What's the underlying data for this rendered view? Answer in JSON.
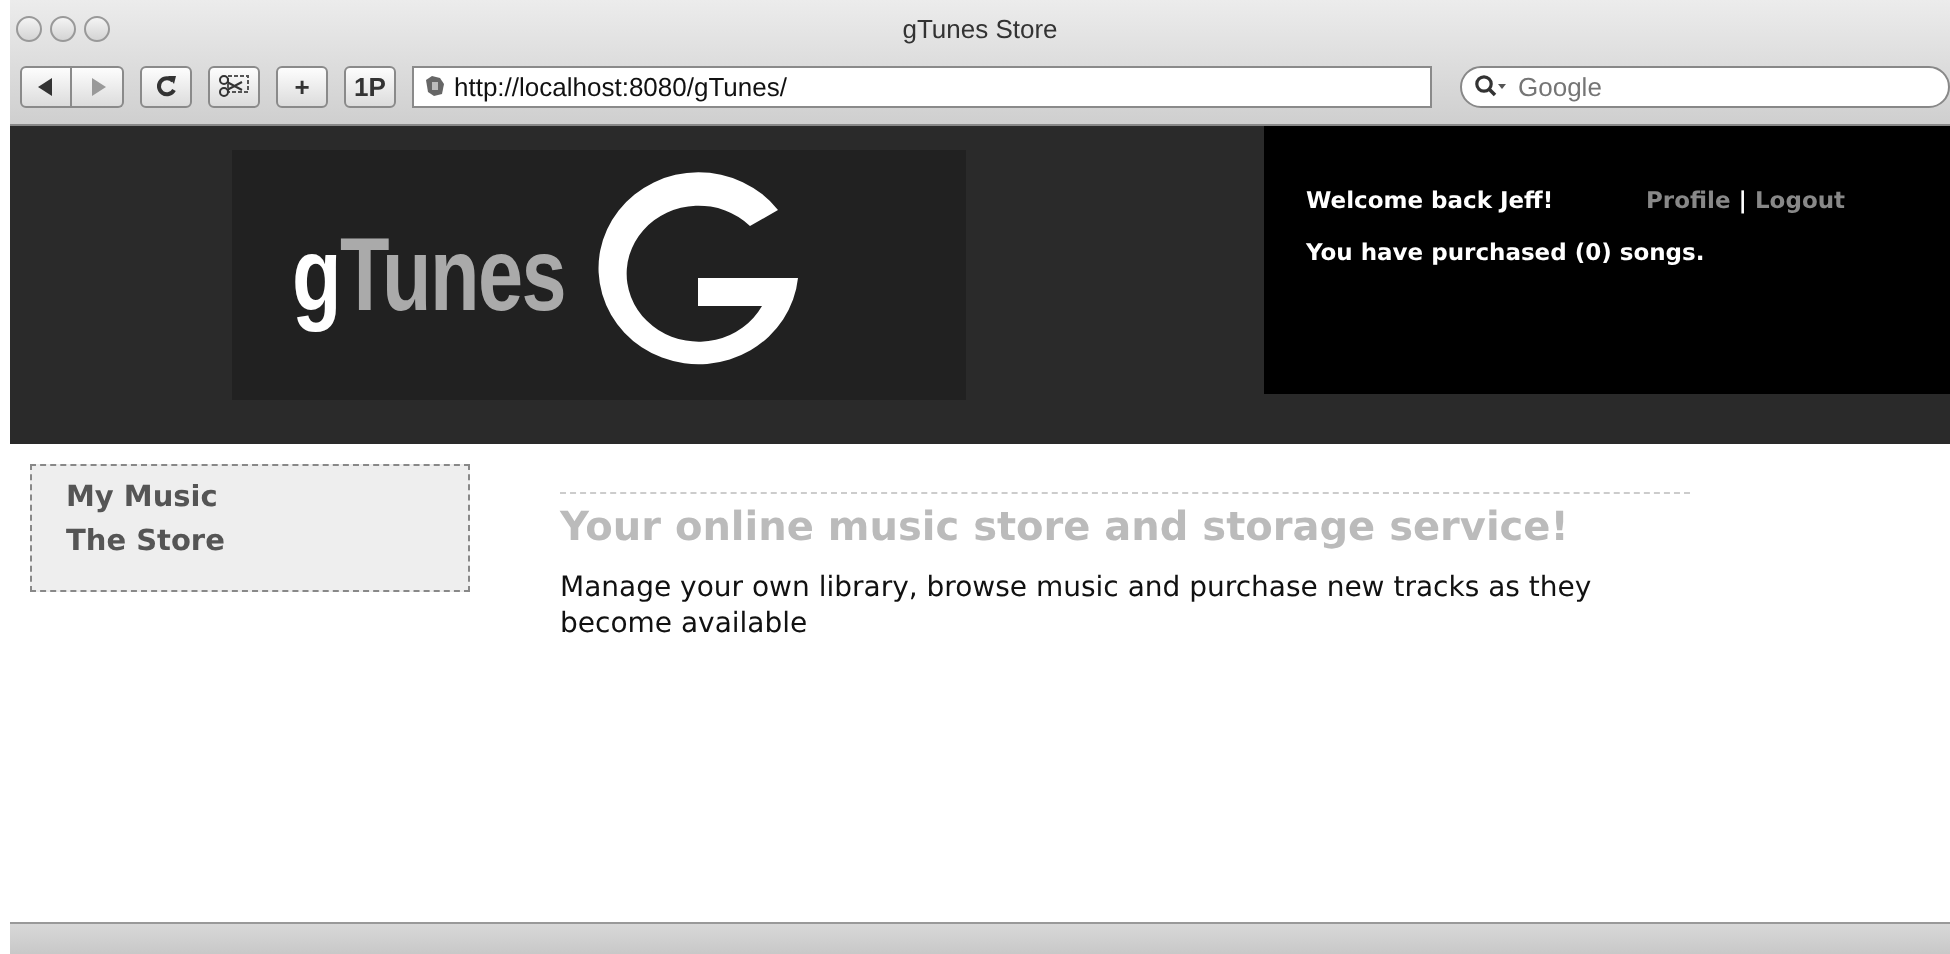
{
  "window": {
    "title": "gTunes Store"
  },
  "toolbar": {
    "buttons": [
      {
        "kind": "back"
      },
      {
        "kind": "forward"
      },
      {
        "kind": "reload"
      },
      {
        "kind": "snip"
      },
      {
        "kind": "text",
        "label": "+"
      },
      {
        "kind": "text",
        "label": "1P"
      }
    ],
    "address": "http://localhost:8080/gTunes/",
    "search": {
      "placeholder": "Google"
    }
  },
  "header": {
    "logo": "gTunes",
    "welcome": "Welcome back Jeff!",
    "links": [
      "Profile",
      "Logout"
    ],
    "separator": "|",
    "purchased": "You have purchased (0) songs."
  },
  "sidebar": {
    "items": [
      {
        "label": "My Music"
      },
      {
        "label": "The Store"
      }
    ]
  },
  "content": {
    "heading": "Your online music store and storage service!",
    "text": "Manage your own library, browse music and purchase new tracks as they become available"
  }
}
